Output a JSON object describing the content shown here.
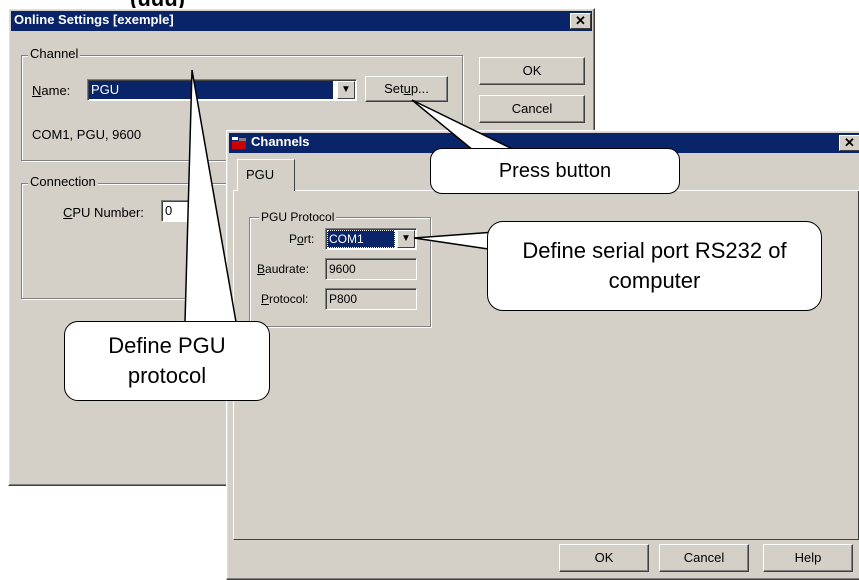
{
  "top_partial_text": "(uuu)",
  "online_settings": {
    "title": "Online Settings [exemple]",
    "close_glyph": "✕",
    "channel_group": "Channel",
    "name_label": "Name:",
    "name_value": "PGU",
    "setup_label": "Setup...",
    "status_text": "COM1, PGU, 9600",
    "connection_group": "Connection",
    "cpu_label": "CPU Number:",
    "cpu_value": "0",
    "ok_label": "OK",
    "cancel_label": "Cancel"
  },
  "channels": {
    "title": "Channels",
    "close_glyph": "✕",
    "tab": "PGU",
    "protocol_group": "PGU Protocol",
    "port_label": "Port:",
    "port_value": "COM1",
    "baudrate_label": "Baudrate:",
    "baudrate_value": "9600",
    "protocol_label": "Protocol:",
    "protocol_value": "P800",
    "ok_label": "OK",
    "cancel_label": "Cancel",
    "help_label": "Help"
  },
  "callouts": {
    "press_button": "Press button",
    "define_serial": "Define serial port RS232 of computer",
    "define_pgu": "Define PGU protocol"
  }
}
